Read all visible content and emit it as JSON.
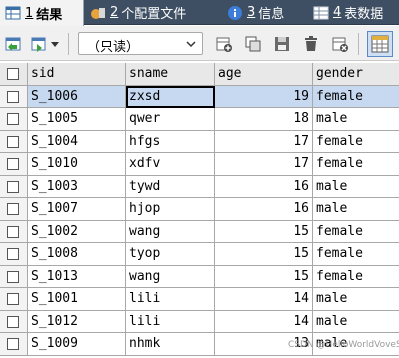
{
  "tabs": [
    {
      "number": "1",
      "label": "结果",
      "icon": "grid-result-icon"
    },
    {
      "number": "2",
      "label": "个配置文件",
      "icon": "profile-icon"
    },
    {
      "number": "3",
      "label": "信息",
      "icon": "info-icon"
    },
    {
      "number": "4",
      "label": "表数据",
      "icon": "table-data-icon"
    }
  ],
  "toolbar": {
    "mode_select": {
      "value": "（只读）"
    }
  },
  "grid": {
    "columns": [
      "sid",
      "sname",
      "age",
      "gender"
    ],
    "rows": [
      {
        "sid": "S_1006",
        "sname": "zxsd",
        "age": "19",
        "gender": "female"
      },
      {
        "sid": "S_1005",
        "sname": "qwer",
        "age": "18",
        "gender": "male"
      },
      {
        "sid": "S_1004",
        "sname": "hfgs",
        "age": "17",
        "gender": "female"
      },
      {
        "sid": "S_1010",
        "sname": "xdfv",
        "age": "17",
        "gender": "female"
      },
      {
        "sid": "S_1003",
        "sname": "tywd",
        "age": "16",
        "gender": "male"
      },
      {
        "sid": "S_1007",
        "sname": "hjop",
        "age": "16",
        "gender": "male"
      },
      {
        "sid": "S_1002",
        "sname": "wang",
        "age": "15",
        "gender": "female"
      },
      {
        "sid": "S_1008",
        "sname": "tyop",
        "age": "15",
        "gender": "female"
      },
      {
        "sid": "S_1013",
        "sname": "wang",
        "age": "15",
        "gender": "female"
      },
      {
        "sid": "S_1001",
        "sname": "lili",
        "age": "14",
        "gender": "male"
      },
      {
        "sid": "S_1012",
        "sname": "lili",
        "age": "14",
        "gender": "male"
      },
      {
        "sid": "S_1009",
        "sname": "nhmk",
        "age": "13",
        "gender": "male"
      }
    ]
  },
  "watermark": "CSDN @HelloWorldVoveSGG",
  "colors": {
    "selected_row": "#c6d9f1",
    "tabbar": "#3f4f63"
  }
}
